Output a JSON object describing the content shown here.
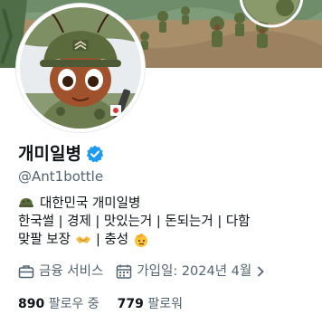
{
  "profile": {
    "display_name": "개미일병",
    "handle": "@Ant1bottle",
    "verified": true,
    "accent_color": "#1d9bf0"
  },
  "bio": {
    "line1_text": "대한민국 개미일병",
    "line1_icon": "soldier-helmet-emoji",
    "line2_text": "한국썰 | 경제 | 맛있는거 | 돈되는거 | 다함",
    "line3_text_a": "맞팔 보장",
    "line3_icon_a": "handshake-emoji",
    "line3_text_b": "| 충성",
    "line3_icon_b": "saluting-face-emoji"
  },
  "meta": {
    "category": "금융 서비스",
    "joined": "가입일: 2024년 4월"
  },
  "stats": {
    "following_count": "890",
    "following_label": "팔로우 중",
    "followers_count": "779",
    "followers_label": "팔로워"
  }
}
